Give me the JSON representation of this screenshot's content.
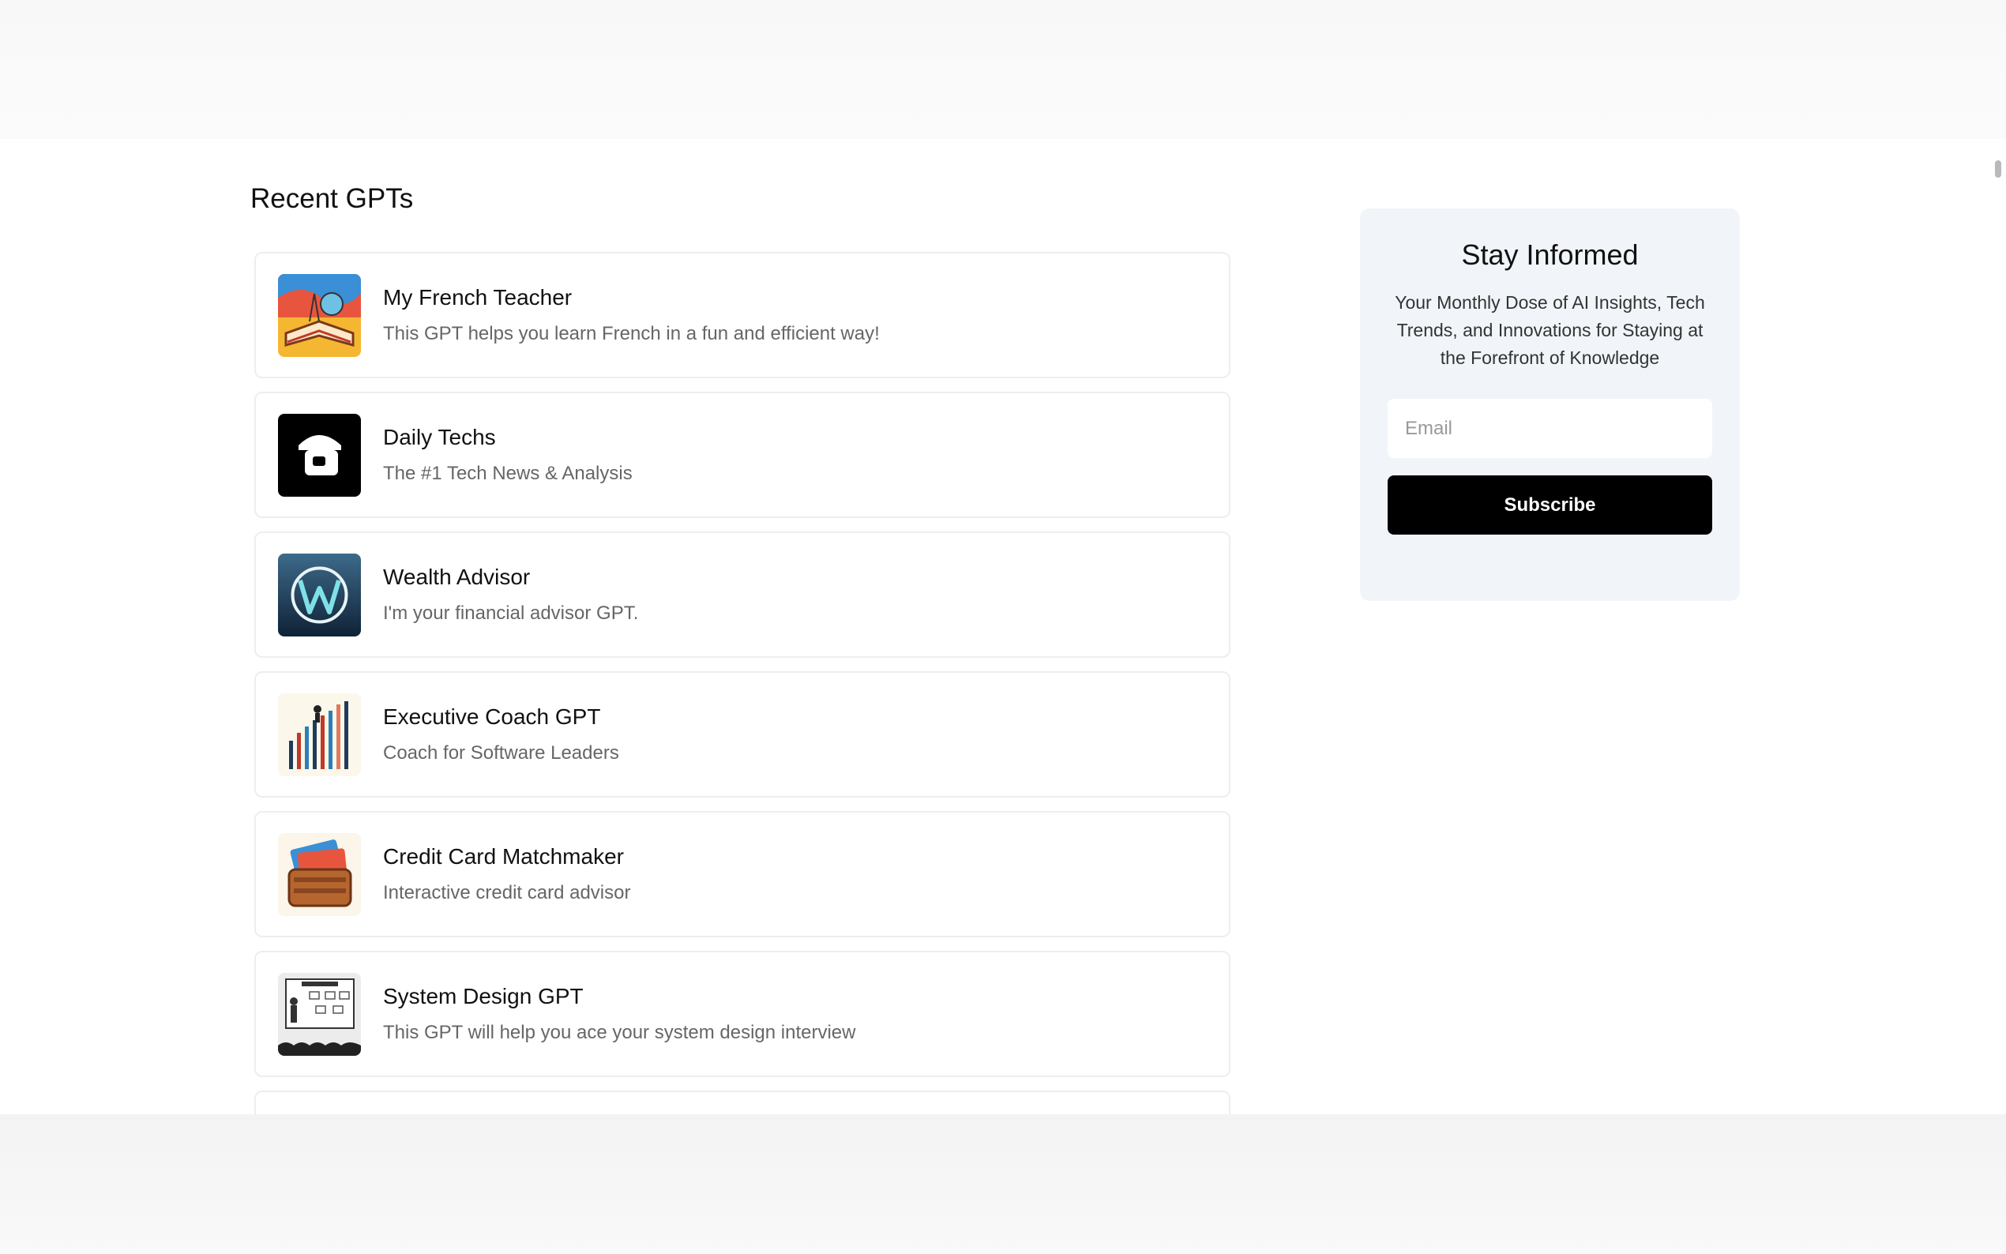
{
  "recent": {
    "title": "Recent GPTs",
    "items": [
      {
        "name": "My French Teacher",
        "description": "This GPT helps you learn French in a fun and efficient way!",
        "icon": "french-teacher-icon"
      },
      {
        "name": "Daily Techs",
        "description": "The #1 Tech News & Analysis",
        "icon": "daily-techs-icon"
      },
      {
        "name": "Wealth Advisor",
        "description": "I'm your financial advisor GPT.",
        "icon": "wealth-advisor-icon"
      },
      {
        "name": "Executive Coach GPT",
        "description": "Coach for Software Leaders",
        "icon": "executive-coach-icon"
      },
      {
        "name": "Credit Card Matchmaker",
        "description": "Interactive credit card advisor",
        "icon": "credit-card-icon"
      },
      {
        "name": "System Design GPT",
        "description": "This GPT will help you ace your system design interview",
        "icon": "system-design-icon"
      }
    ]
  },
  "newsletter": {
    "title": "Stay Informed",
    "description": "Your Monthly Dose of AI Insights, Tech Trends, and Innovations for Staying at the Forefront of Knowledge",
    "email_placeholder": "Email",
    "button_label": "Subscribe"
  },
  "colors": {
    "button_bg": "#000000",
    "panel_bg": "#f1f5f9",
    "card_border": "#eeeeee"
  }
}
